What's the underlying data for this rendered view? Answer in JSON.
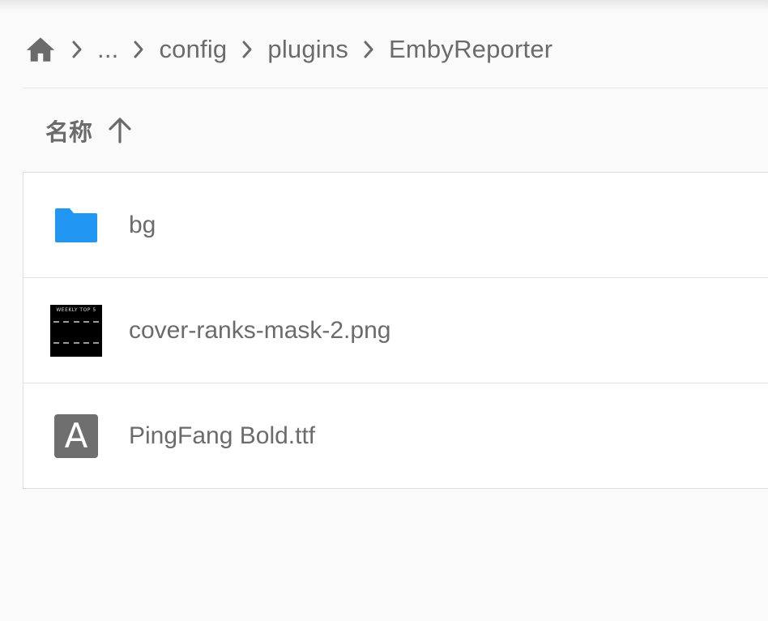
{
  "breadcrumb": {
    "home_icon": "home-icon",
    "items": [
      "...",
      "config",
      "plugins",
      "EmbyReporter"
    ]
  },
  "list_header": {
    "name_label": "名称",
    "sort_icon": "arrow-up-icon",
    "sort_direction": "ascending"
  },
  "files": [
    {
      "name": "bg",
      "type": "folder",
      "icon": "folder-icon",
      "icon_color": "#2196f3"
    },
    {
      "name": "cover-ranks-mask-2.png",
      "type": "image",
      "icon": "image-thumbnail",
      "thumbnail_title": "WEEKLY TOP 5"
    },
    {
      "name": "PingFang Bold.ttf",
      "type": "font",
      "icon": "font-icon",
      "icon_letter": "A"
    }
  ],
  "colors": {
    "background": "#fafafa",
    "text": "#6b6b6b",
    "folder": "#2196f3",
    "font_icon_bg": "#6f6f6f"
  }
}
